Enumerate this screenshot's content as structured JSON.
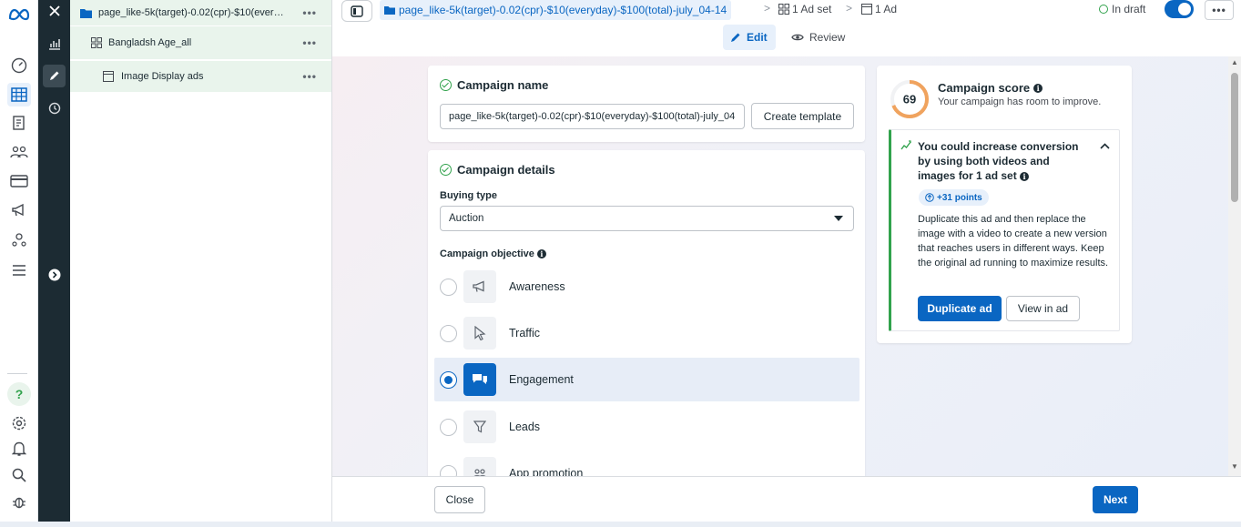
{
  "tree": {
    "campaign": "page_like-5k(target)-0.02(cpr)-$10(every...",
    "adset": "Bangladsh Age_all",
    "ad": "Image Display ads",
    "more": "•••"
  },
  "breadcrumb": {
    "campaign": "page_like-5k(target)-0.02(cpr)-$10(everyday)-$100(total)-july_04-14",
    "adset": "1 Ad set",
    "ad": "1 Ad",
    "sep": ">"
  },
  "status": {
    "label": "In draft"
  },
  "more_menu": "•••",
  "tabs": {
    "edit": "Edit",
    "review": "Review"
  },
  "campaign_name": {
    "title": "Campaign name",
    "value": "page_like-5k(target)-0.02(cpr)-$10(everyday)-$100(total)-july_04",
    "create_template": "Create template"
  },
  "campaign_details": {
    "title": "Campaign details",
    "buying_type_label": "Buying type",
    "buying_type_value": "Auction",
    "objective_label": "Campaign objective",
    "objectives": [
      {
        "label": "Awareness",
        "selected": false
      },
      {
        "label": "Traffic",
        "selected": false
      },
      {
        "label": "Engagement",
        "selected": true
      },
      {
        "label": "Leads",
        "selected": false
      },
      {
        "label": "App promotion",
        "selected": false
      }
    ]
  },
  "score": {
    "value": "69",
    "progress": 0.69,
    "title": "Campaign score",
    "subtitle": "Your campaign has room to improve.",
    "tip_title": "You could increase conversion by using both videos and images for 1 ad set",
    "points": "+31 points",
    "tip_body": "Duplicate this ad and then replace the image with a video to create a new version that reaches users in different ways. Keep the original ad running to maximize results.",
    "duplicate_button": "Duplicate ad",
    "view_button": "View in ad"
  },
  "footer": {
    "close": "Close",
    "next": "Next"
  },
  "colors": {
    "accent": "#0a66c2",
    "success": "#31a24c",
    "score_ring": "#f0a35e",
    "dark_strip": "#1c2b33"
  }
}
